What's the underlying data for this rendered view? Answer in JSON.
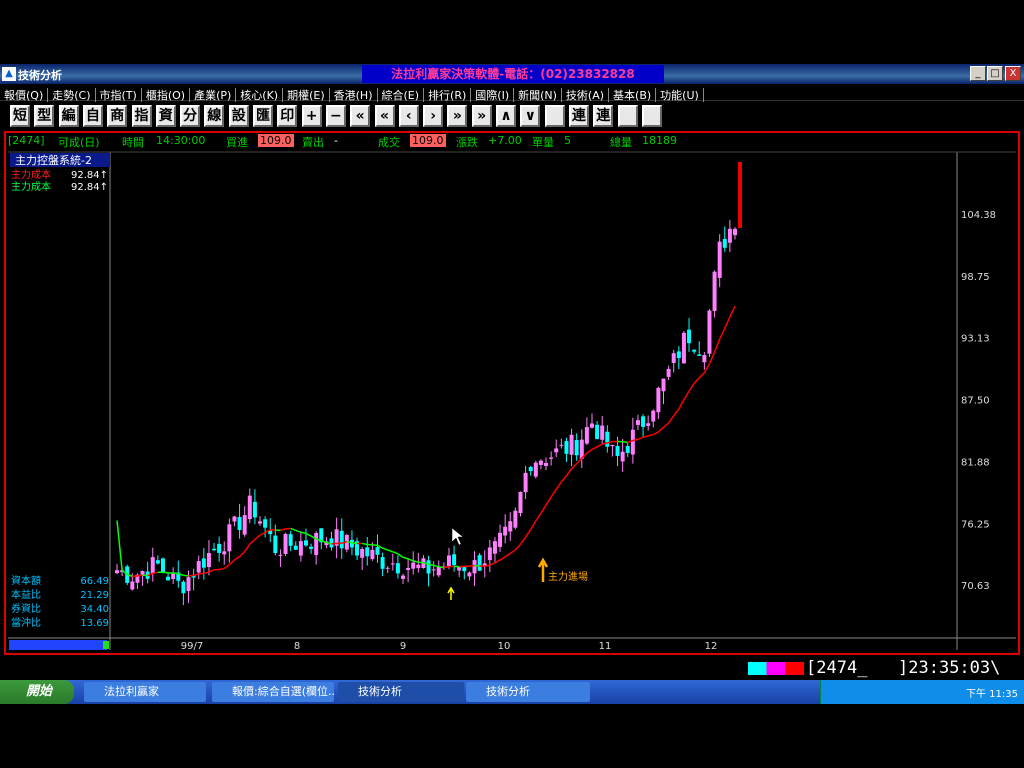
{
  "window": {
    "title": "技術分析",
    "center_title": "法拉利贏家決策軟體-電話：(02)23832828",
    "min": "_",
    "max": "□",
    "close": "X"
  },
  "menu": [
    "報價(Q)",
    "走勢(C)",
    "市指(T)",
    "櫃指(O)",
    "產業(P)",
    "核心(K)",
    "期權(E)",
    "香港(H)",
    "綜合(E)",
    "排行(R)",
    "國際(I)",
    "新聞(N)",
    "技術(A)",
    "基本(B)",
    "功能(U)"
  ],
  "toolbar": [
    "短",
    "型",
    "編",
    "自",
    "商",
    "指",
    "資",
    "分",
    "線",
    "設",
    "匯",
    "印",
    "+",
    "−",
    "«",
    "«",
    "‹",
    "›",
    "»",
    "»",
    "∧",
    "∨",
    "",
    "連",
    "連",
    "",
    ""
  ],
  "info": {
    "code": "[2474]",
    "name": "可成(日)",
    "time_label": "時間",
    "time": "14:30:00",
    "bid_label": "買進",
    "bid": "109.0",
    "ask_label": "賣出",
    "ask": "-",
    "deal_label": "成交",
    "deal": "109.0",
    "chg_label": "漲跌",
    "chg": "+7.00",
    "unit_label": "單量",
    "unit": "5",
    "vol_label": "總量",
    "vol": "18189"
  },
  "indicator": {
    "title": "主力控盤系統-2",
    "rows": [
      {
        "label": "主力成本",
        "value": "92.84↑",
        "color": "#ff2020"
      },
      {
        "label": "主力成本",
        "value": "92.84↑",
        "color": "#00ff40"
      }
    ]
  },
  "stats": [
    {
      "label": "資本額",
      "value": "66.49"
    },
    {
      "label": "本益比",
      "value": "21.29"
    },
    {
      "label": "券資比",
      "value": "34.40"
    },
    {
      "label": "當沖比",
      "value": "13.69"
    }
  ],
  "annotation": "主力進場",
  "status": {
    "code": "2474_",
    "time": "23:35:03"
  },
  "taskbar": {
    "start": "開始",
    "tasks": [
      "法拉利贏家",
      "報價:綜合自選(欄位...",
      "技術分析",
      "技術分析"
    ],
    "clock": "下午 11:35"
  },
  "colors": {
    "up": "#ff80ff",
    "down": "#00ffff",
    "ma_up": "#ff0000",
    "ma_down": "#00ff00",
    "frame": "#dd0000"
  },
  "chart_data": {
    "type": "candlestick",
    "ylim": [
      66,
      110
    ],
    "yticks": [
      104.38,
      98.75,
      93.13,
      87.5,
      81.88,
      76.25,
      70.63
    ],
    "x_labels": [
      "99/7",
      "8",
      "9",
      "10",
      "11",
      "12"
    ],
    "candles": []
  }
}
